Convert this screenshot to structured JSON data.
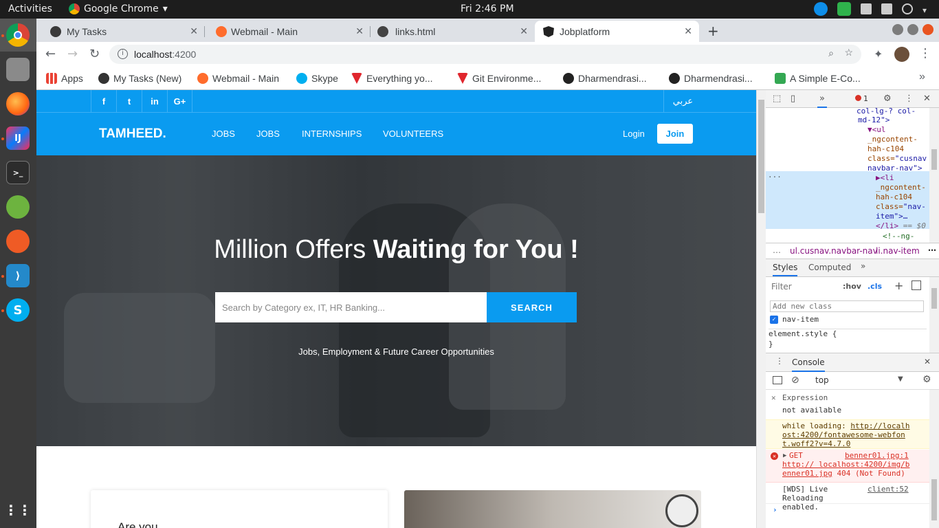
{
  "system": {
    "activities": "Activities",
    "app_name": "Google Chrome",
    "clock": "Fri  2:46 PM"
  },
  "tabs": [
    {
      "label": "My Tasks"
    },
    {
      "label": "Webmail - Main"
    },
    {
      "label": "links.html"
    },
    {
      "label": "Jobplatform"
    }
  ],
  "omnibox": {
    "host": "localhost",
    "port": ":4200"
  },
  "bookmarks": [
    {
      "label": "Apps"
    },
    {
      "label": "My Tasks (New)"
    },
    {
      "label": "Webmail - Main"
    },
    {
      "label": "Skype"
    },
    {
      "label": "Everything yo..."
    },
    {
      "label": "Git Environme..."
    },
    {
      "label": "Dharmendrasi..."
    },
    {
      "label": "Dharmendrasi..."
    },
    {
      "label": "A Simple E-Co..."
    }
  ],
  "site": {
    "social": [
      "f",
      "t",
      "in",
      "G+"
    ],
    "language": "عربي",
    "logo": "TAMHEED.",
    "nav": [
      "JOBS",
      "JOBS",
      "INTERNSHIPS",
      "VOLUNTEERS"
    ],
    "login": "Login",
    "join": "Join",
    "headline_light": "Million Offers ",
    "headline_bold": "Waiting for You !",
    "search_placeholder": "Search by Category ex, IT, HR Banking...",
    "search_button": "SEARCH",
    "tagline": "Jobs, Employment & Future Career Opportunities",
    "card_text": "Are you"
  },
  "devtools": {
    "error_count": "1",
    "elements": {
      "line1": "col-lg-? col-",
      "line2": "md-12\">",
      "ul_tag": "▼<ul",
      "ng1": "_ngcontent-",
      "ng2": "hah-c104",
      "class_attr": "class=",
      "class_val1": "\"cusnav",
      "class_val2": "navbar-nav\">",
      "li_tag": "▶<li",
      "li_ng1": "_ngcontent-",
      "li_ng2": "hah-c104",
      "li_class": "class=",
      "li_class_val1": "\"nav-",
      "li_class_val2": "item\">…",
      "li_close": "</li>",
      "li_eq": " == $0",
      "comment": "<!--ng-"
    },
    "breadcrumb": [
      "ul.cusnav.navbar-nav",
      "li.nav-item"
    ],
    "style_tabs": [
      "Styles",
      "Computed"
    ],
    "filter_placeholder": "Filter",
    "hov": ":hov",
    "cls": ".cls",
    "add_class_placeholder": "Add new class",
    "class_checkbox": "nav-item",
    "element_style": "element.style {",
    "element_style_close": "}",
    "console_tab": "Console",
    "context": "top",
    "expression_label": "Expression",
    "expression_value": "not available",
    "warn_text": "while loading: ",
    "warn_link": "http://localhost:4200/fontawesome-webfont.woff2?v=4.7.0",
    "err_method": "GET ",
    "err_link": "http:// localhost:4200/img/benner01.jpg",
    "err_source": "benner01.jpg:1",
    "err_status": " 404 (Not Found)",
    "info_text": "[WDS] Live Reloading enabled.",
    "info_source": "client:52"
  }
}
